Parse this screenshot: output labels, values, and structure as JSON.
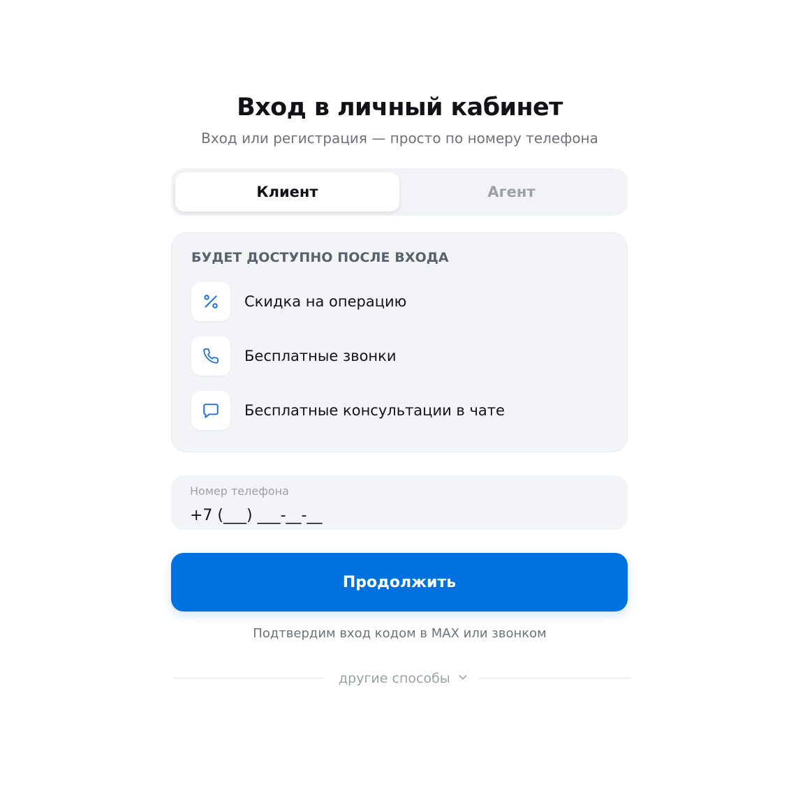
{
  "header": {
    "title": "Вход в личный кабинет",
    "subtitle": "Вход или регистрация — просто по номеру телефона"
  },
  "tabs": [
    {
      "label": "Клиент",
      "active": true
    },
    {
      "label": "Агент",
      "active": false
    }
  ],
  "benefits": {
    "title": "БУДЕТ ДОСТУПНО ПОСЛЕ ВХОДА",
    "items": [
      {
        "icon": "percent-icon",
        "label": "Скидка на операцию"
      },
      {
        "icon": "phone-icon",
        "label": "Бесплатные звонки"
      },
      {
        "icon": "chat-icon",
        "label": "Бесплатные консультации в чате"
      }
    ]
  },
  "phone_field": {
    "label": "Номер телефона",
    "placeholder": "+7 (___) ___-__-__",
    "value": ""
  },
  "continue_button": {
    "label": "Продолжить"
  },
  "hint": "Подтвердим вход кодом в MAX или звонком",
  "other_ways": {
    "label": "другие способы",
    "icon": "chevron-down-icon"
  },
  "colors": {
    "accent": "#0072e0",
    "icon_accent": "#1f6fe0",
    "muted": "#9ba0a9",
    "panel": "#f3f4f7"
  }
}
